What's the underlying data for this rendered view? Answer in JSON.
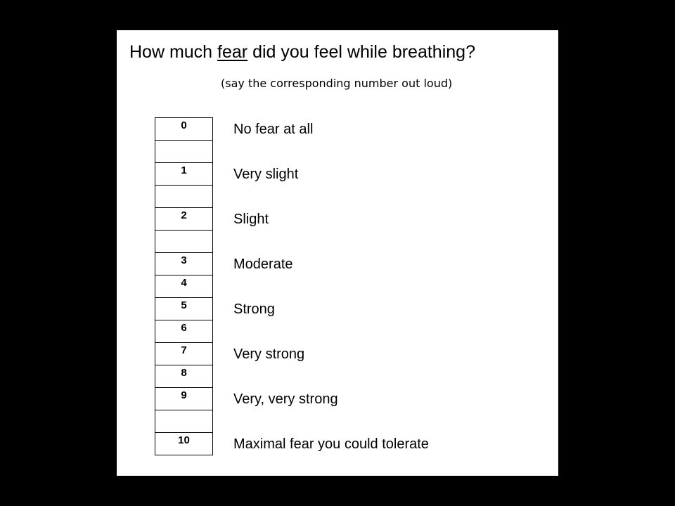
{
  "title": {
    "before": "How much ",
    "emphasis": "fear",
    "after": " did you feel while breathing?"
  },
  "subtitle": "(say the corresponding number out loud)",
  "scale": {
    "rows": [
      "0",
      "",
      "1",
      "",
      "2",
      "",
      "3",
      "4",
      "5",
      "6",
      "7",
      "8",
      "9",
      "",
      "10"
    ],
    "labels": [
      {
        "row": 0,
        "text": "No fear at all"
      },
      {
        "row": 2,
        "text": "Very slight"
      },
      {
        "row": 4,
        "text": "Slight"
      },
      {
        "row": 6,
        "text": "Moderate"
      },
      {
        "row": 8,
        "text": "Strong"
      },
      {
        "row": 10,
        "text": "Very strong"
      },
      {
        "row": 12,
        "text": "Very, very strong"
      },
      {
        "row": 14,
        "text": "Maximal fear you could tolerate"
      }
    ]
  }
}
